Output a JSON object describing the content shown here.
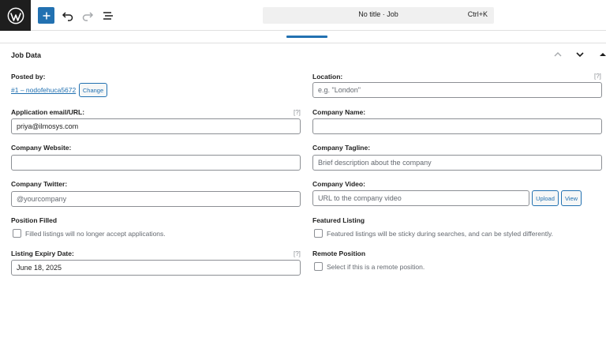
{
  "topbar": {
    "logo_icon": "wordpress-icon",
    "add_icon": "plus-icon",
    "undo_icon": "undo-icon",
    "redo_icon": "redo-icon",
    "outline_icon": "list-view-icon",
    "document_title": "No title · Job",
    "shortcut": "Ctrl+K"
  },
  "panel": {
    "title": "Job Data",
    "up_icon": "chevron-up-icon",
    "down_icon": "chevron-down-icon",
    "toggle_icon": "triangle-up-icon"
  },
  "form": {
    "posted_by": {
      "label": "Posted by:",
      "link": "#1 – nodofehuca5672",
      "button": "Change"
    },
    "location": {
      "label": "Location:",
      "help": "[?]",
      "placeholder": "e.g. \"London\""
    },
    "application": {
      "label": "Application email/URL:",
      "help": "[?]",
      "value": "priya@ilmosys.com"
    },
    "company_name": {
      "label": "Company Name:",
      "value": ""
    },
    "company_website": {
      "label": "Company Website:",
      "value": ""
    },
    "company_tagline": {
      "label": "Company Tagline:",
      "placeholder": "Brief description about the company"
    },
    "company_twitter": {
      "label": "Company Twitter:",
      "placeholder": "@yourcompany"
    },
    "company_video": {
      "label": "Company Video:",
      "placeholder": "URL to the company video",
      "upload": "Upload",
      "view": "View"
    },
    "position_filled": {
      "label": "Position Filled",
      "checkbox_text": "Filled listings will no longer accept applications."
    },
    "featured_listing": {
      "label": "Featured Listing",
      "checkbox_text": "Featured listings will be sticky during searches, and can be styled differently."
    },
    "expiry": {
      "label": "Listing Expiry Date:",
      "help": "[?]",
      "value": "June 18, 2025"
    },
    "remote": {
      "label": "Remote Position",
      "checkbox_text": "Select if this is a remote position."
    }
  }
}
